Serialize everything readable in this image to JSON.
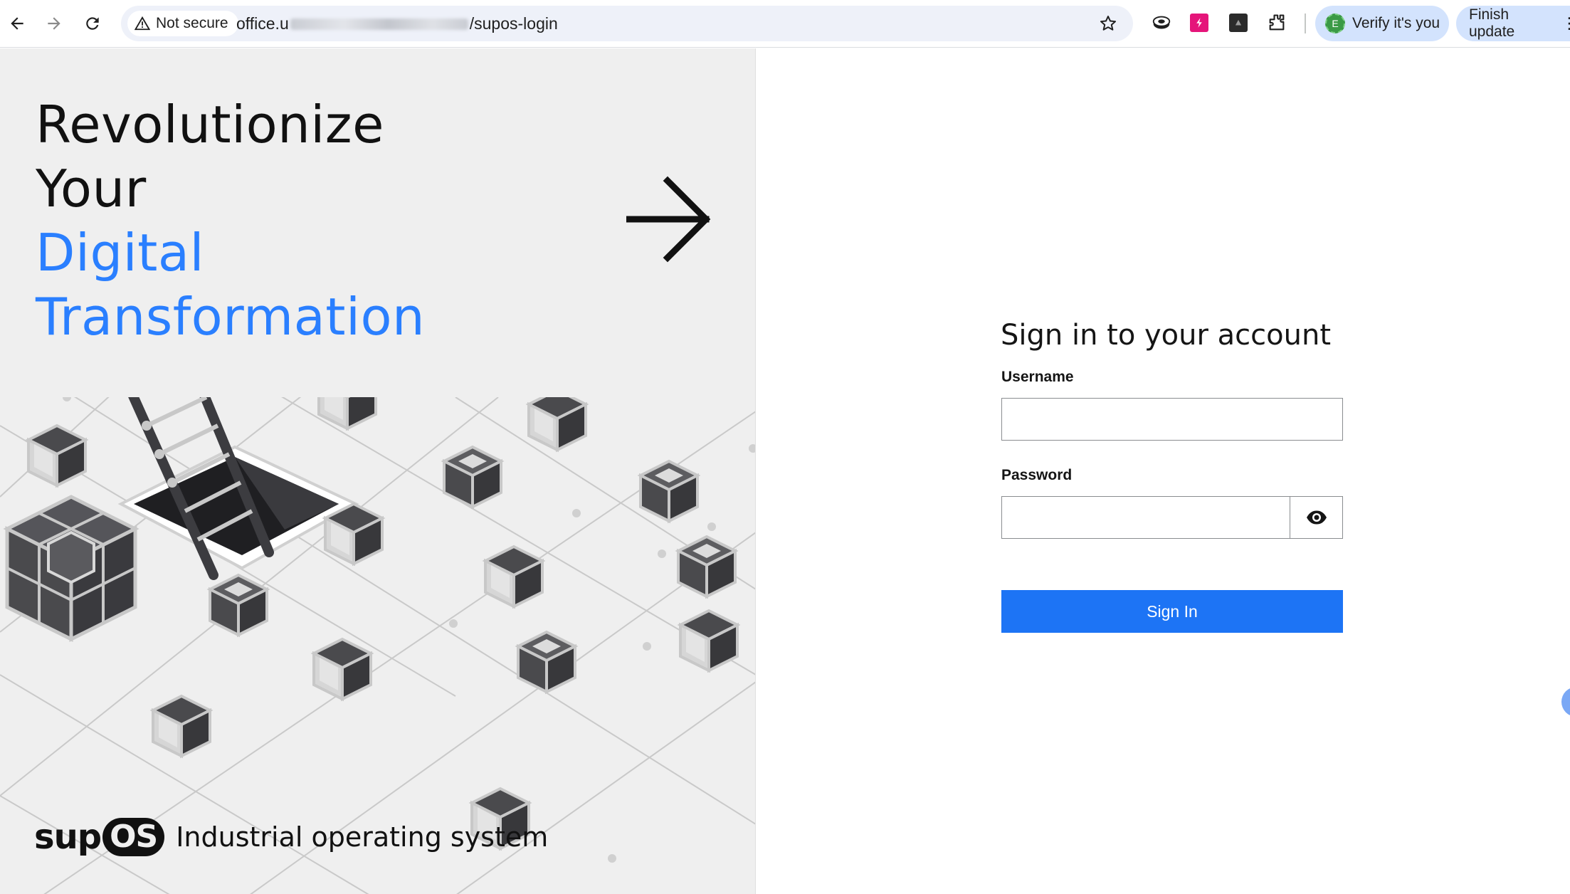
{
  "browser": {
    "security_label": "Not secure",
    "url_prefix": "office.u",
    "url_suffix": "/supos-login",
    "verify_label": "Verify it's you",
    "verify_avatar": "E",
    "update_label": "Finish update",
    "icons": [
      "back-arrow-icon",
      "forward-arrow-icon",
      "reload-icon",
      "warning-icon",
      "star-icon",
      "extension-icon",
      "puzzle-icon",
      "more-icon"
    ]
  },
  "hero": {
    "line1": "Revolutionize",
    "line2": "Your",
    "line3": "Digital",
    "line4": "Transformation",
    "brand_logo_text": "sup",
    "brand_logo_badge": "OS",
    "brand_tagline": "Industrial operating system",
    "colors": {
      "accent": "#2a7fff",
      "background": "#efefef",
      "text": "#111111"
    }
  },
  "login": {
    "title": "Sign in to your account",
    "username_label": "Username",
    "username_value": "",
    "password_label": "Password",
    "password_value": "",
    "submit_label": "Sign In",
    "colors": {
      "button": "#1d74f5",
      "border": "#8a8d90"
    }
  }
}
